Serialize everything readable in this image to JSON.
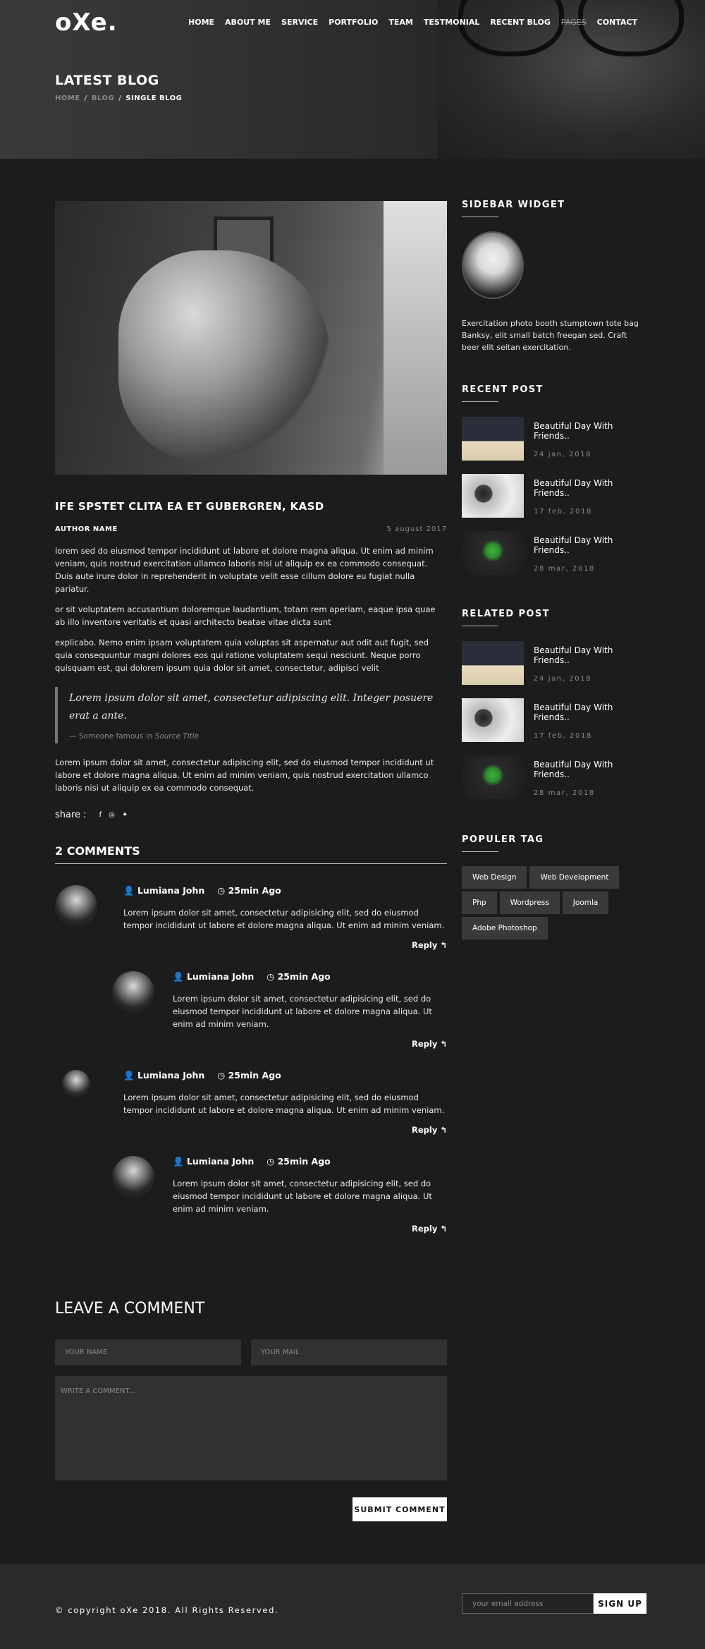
{
  "header": {
    "logo": "oXe.",
    "nav": [
      "HOME",
      "ABOUT ME",
      "SERVICE",
      "PORTFOLIO",
      "TEAM",
      "TESTMONIAL",
      "RECENT BLOG",
      "PAGES",
      "CONTACT"
    ],
    "page_title": "LATEST BLOG",
    "breadcrumb": {
      "home": "HOME",
      "blog": "BLOG",
      "current": "SINGLE BLOG",
      "sep": "/"
    }
  },
  "post": {
    "title": "IFE SPSTET CLITA EA ET GUBERGREN, KASD",
    "author": "AUTHOR NAME",
    "date": "5 august 2017",
    "paragraphs": [
      "lorem sed do eiusmod tempor incididunt ut labore et dolore magna aliqua. Ut enim ad minim veniam, quis nostrud exercitation ullamco laboris nisi ut aliquip ex ea commodo consequat. Duis aute irure dolor in reprehenderit in voluptate velit esse cillum dolore eu fugiat nulla pariatur.",
      "or sit voluptatem accusantium doloremque laudantium, totam rem aperiam, eaque ipsa quae ab illo inventore veritatis et quasi architecto beatae vitae dicta sunt",
      "explicabo. Nemo enim ipsam voluptatem quia voluptas sit aspernatur aut odit aut fugit, sed quia consequuntur magni dolores eos qui ratione voluptatem sequi nesciunt. Neque porro quisquam est, qui dolorem ipsum quia dolor sit amet, consectetur, adipisci velit"
    ],
    "quote": "Lorem ipsum dolor sit amet, consectetur adipiscing elit. Integer posuere erat a ante.",
    "quote_source_prefix": "— Someone famous in",
    "quote_source_title": "Source Title",
    "closing_paragraph": "Lorem ipsum dolor sit amet, consectetur adipiscing elit, sed do eiusmod tempor incididunt ut labore et dolore magna aliqua. Ut enim ad minim veniam, quis nostrud exercitation ullamco laboris nisi ut aliquip ex ea commodo consequat.",
    "share_label": "share :",
    "share_icons": [
      "f",
      "◎",
      "✦"
    ]
  },
  "comments": {
    "heading": "2 COMMENTS",
    "items": [
      {
        "name": "Lumiana John",
        "time": "25min Ago",
        "text": "Lorem ipsum dolor sit amet, consectetur adipisicing elit, sed do eiusmod tempor incididunt ut labore et dolore magna aliqua. Ut enim ad minim veniam.",
        "reply": "Reply ↰"
      },
      {
        "name": "Lumiana John",
        "time": "25min Ago",
        "text": "Lorem ipsum dolor sit amet, consectetur adipisicing elit, sed do eiusmod tempor incididunt ut labore et dolore magna aliqua. Ut enim ad minim veniam.",
        "reply": "Reply ↰"
      },
      {
        "name": "Lumiana John",
        "time": "25min Ago",
        "text": "Lorem ipsum dolor sit amet, consectetur adipisicing elit, sed do eiusmod tempor incididunt ut labore et dolore magna aliqua. Ut enim ad minim veniam.",
        "reply": "Reply ↰"
      },
      {
        "name": "Lumiana John",
        "time": "25min Ago",
        "text": "Lorem ipsum dolor sit amet, consectetur adipisicing elit, sed do eiusmod tempor incididunt ut labore et dolore magna aliqua. Ut enim ad minim veniam.",
        "reply": "Reply ↰"
      }
    ]
  },
  "leave_comment": {
    "heading": "LEAVE A COMMENT",
    "name_placeholder": "YOUR NAME",
    "mail_placeholder": "YOUR MAIL",
    "comment_placeholder": "WRITE A COMMENT...",
    "submit": "SUBMIT COMMENT"
  },
  "sidebar": {
    "widget_heading": "SIDEBAR WIDGET",
    "about": "Exercitation photo booth stumptown tote bag Banksy, elit small batch freegan sed. Craft beer elit seitan exercitation.",
    "recent_heading": "RECENT POST",
    "recent": [
      {
        "title": "Beautiful Day With Friends..",
        "date": "24 jan, 2018"
      },
      {
        "title": "Beautiful Day With Friends..",
        "date": "17 feb, 2018"
      },
      {
        "title": "Beautiful Day With Friends..",
        "date": "28 mar, 2018"
      }
    ],
    "related_heading": "RELATED POST",
    "related": [
      {
        "title": "Beautiful Day With Friends..",
        "date": "24 jan, 2018"
      },
      {
        "title": "Beautiful Day With Friends..",
        "date": "17 feb, 2018"
      },
      {
        "title": "Beautiful Day With Friends..",
        "date": "28 mar, 2018"
      }
    ],
    "tags_heading": "POPULER TAG",
    "tags": [
      "Web Design",
      "Web Development",
      "Php",
      "Wordpress",
      "Joomla",
      "Adobe Photoshop"
    ]
  },
  "footer": {
    "copyright": "© copyright oXe 2018. All Rights Reserved.",
    "email_placeholder": "your email address",
    "signup": "SIGN UP"
  },
  "icons": {
    "user": "👤",
    "clock": "◷"
  }
}
